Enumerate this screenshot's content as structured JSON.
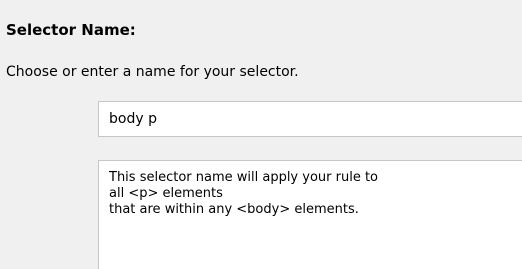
{
  "selector_section": {
    "title": "Selector Name:",
    "instruction": "Choose or enter a name for your selector.",
    "name_input_value": "body p",
    "description_lines": [
      "This selector name will apply your rule to",
      "all <p> elements",
      "that are within any <body> elements."
    ]
  }
}
